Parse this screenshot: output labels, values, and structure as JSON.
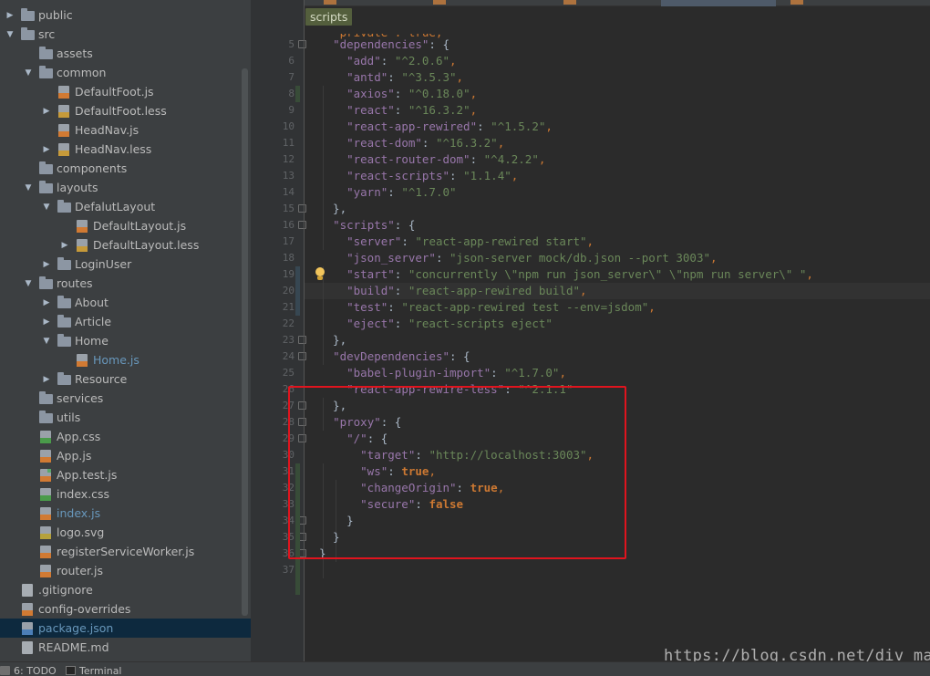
{
  "tree": [
    {
      "label": "public",
      "kind": "folder",
      "depth": 0,
      "arrow": "collapsed"
    },
    {
      "label": "src",
      "kind": "folder",
      "depth": 0,
      "arrow": "expanded"
    },
    {
      "label": "assets",
      "kind": "folder",
      "depth": 1,
      "arrow": "none"
    },
    {
      "label": "common",
      "kind": "folder",
      "depth": 1,
      "arrow": "expanded"
    },
    {
      "label": "DefaultFoot.js",
      "kind": "js",
      "depth": 2,
      "arrow": "none"
    },
    {
      "label": "DefaultFoot.less",
      "kind": "less",
      "depth": 2,
      "arrow": "collapsed"
    },
    {
      "label": "HeadNav.js",
      "kind": "js",
      "depth": 2,
      "arrow": "none"
    },
    {
      "label": "HeadNav.less",
      "kind": "less",
      "depth": 2,
      "arrow": "collapsed"
    },
    {
      "label": "components",
      "kind": "folder",
      "depth": 1,
      "arrow": "none"
    },
    {
      "label": "layouts",
      "kind": "folder",
      "depth": 1,
      "arrow": "expanded"
    },
    {
      "label": "DefalutLayout",
      "kind": "folder",
      "depth": 2,
      "arrow": "expanded"
    },
    {
      "label": "DefaultLayout.js",
      "kind": "js",
      "depth": 3,
      "arrow": "none"
    },
    {
      "label": "DefaultLayout.less",
      "kind": "less",
      "depth": 3,
      "arrow": "collapsed"
    },
    {
      "label": "LoginUser",
      "kind": "folder",
      "depth": 2,
      "arrow": "collapsed"
    },
    {
      "label": "routes",
      "kind": "folder",
      "depth": 1,
      "arrow": "expanded"
    },
    {
      "label": "About",
      "kind": "folder",
      "depth": 2,
      "arrow": "collapsed"
    },
    {
      "label": "Article",
      "kind": "folder",
      "depth": 2,
      "arrow": "collapsed"
    },
    {
      "label": "Home",
      "kind": "folder",
      "depth": 2,
      "arrow": "expanded"
    },
    {
      "label": "Home.js",
      "kind": "js",
      "depth": 3,
      "arrow": "none",
      "modified": true
    },
    {
      "label": "Resource",
      "kind": "folder",
      "depth": 2,
      "arrow": "collapsed"
    },
    {
      "label": "services",
      "kind": "folder",
      "depth": 1,
      "arrow": "none"
    },
    {
      "label": "utils",
      "kind": "folder",
      "depth": 1,
      "arrow": "none"
    },
    {
      "label": "App.css",
      "kind": "css",
      "depth": 1,
      "arrow": "none"
    },
    {
      "label": "App.js",
      "kind": "js",
      "depth": 1,
      "arrow": "none"
    },
    {
      "label": "App.test.js",
      "kind": "test",
      "depth": 1,
      "arrow": "none"
    },
    {
      "label": "index.css",
      "kind": "css",
      "depth": 1,
      "arrow": "none"
    },
    {
      "label": "index.js",
      "kind": "js",
      "depth": 1,
      "arrow": "none",
      "modified": true
    },
    {
      "label": "logo.svg",
      "kind": "svg",
      "depth": 1,
      "arrow": "none"
    },
    {
      "label": "registerServiceWorker.js",
      "kind": "js",
      "depth": 1,
      "arrow": "none"
    },
    {
      "label": "router.js",
      "kind": "js",
      "depth": 1,
      "arrow": "none"
    },
    {
      "label": ".gitignore",
      "kind": "plain",
      "depth": 0,
      "arrow": "none"
    },
    {
      "label": "config-overrides",
      "kind": "js",
      "depth": 0,
      "arrow": "none"
    },
    {
      "label": "package.json",
      "kind": "json",
      "depth": 0,
      "arrow": "none",
      "selected": true,
      "modified": true
    },
    {
      "label": "README.md",
      "kind": "plain",
      "depth": 0,
      "arrow": "none"
    }
  ],
  "editor": {
    "breadcrumb": "scripts",
    "partial_top_line": "  \"private\": true,",
    "lines": [
      {
        "n": "5",
        "t": [
          [
            "w",
            "  "
          ],
          [
            "k",
            "\"dependencies\""
          ],
          [
            "w",
            ": {"
          ]
        ]
      },
      {
        "n": "6",
        "t": [
          [
            "w",
            "    "
          ],
          [
            "k",
            "\"add\""
          ],
          [
            "w",
            ": "
          ],
          [
            "s",
            "\"^2.0.6\""
          ],
          [
            "p",
            ","
          ]
        ]
      },
      {
        "n": "7",
        "t": [
          [
            "w",
            "    "
          ],
          [
            "k",
            "\"antd\""
          ],
          [
            "w",
            ": "
          ],
          [
            "s",
            "\"^3.5.3\""
          ],
          [
            "p",
            ","
          ]
        ]
      },
      {
        "n": "8",
        "t": [
          [
            "w",
            "    "
          ],
          [
            "k",
            "\"axios\""
          ],
          [
            "w",
            ": "
          ],
          [
            "s",
            "\"^0.18.0\""
          ],
          [
            "p",
            ","
          ]
        ]
      },
      {
        "n": "9",
        "t": [
          [
            "w",
            "    "
          ],
          [
            "k",
            "\"react\""
          ],
          [
            "w",
            ": "
          ],
          [
            "s",
            "\"^16.3.2\""
          ],
          [
            "p",
            ","
          ]
        ]
      },
      {
        "n": "10",
        "t": [
          [
            "w",
            "    "
          ],
          [
            "k",
            "\"react-app-rewired\""
          ],
          [
            "w",
            ": "
          ],
          [
            "s",
            "\"^1.5.2\""
          ],
          [
            "p",
            ","
          ]
        ]
      },
      {
        "n": "11",
        "t": [
          [
            "w",
            "    "
          ],
          [
            "k",
            "\"react-dom\""
          ],
          [
            "w",
            ": "
          ],
          [
            "s",
            "\"^16.3.2\""
          ],
          [
            "p",
            ","
          ]
        ]
      },
      {
        "n": "12",
        "t": [
          [
            "w",
            "    "
          ],
          [
            "k",
            "\"react-router-dom\""
          ],
          [
            "w",
            ": "
          ],
          [
            "s",
            "\"^4.2.2\""
          ],
          [
            "p",
            ","
          ]
        ]
      },
      {
        "n": "13",
        "t": [
          [
            "w",
            "    "
          ],
          [
            "k",
            "\"react-scripts\""
          ],
          [
            "w",
            ": "
          ],
          [
            "s",
            "\"1.1.4\""
          ],
          [
            "p",
            ","
          ]
        ]
      },
      {
        "n": "14",
        "t": [
          [
            "w",
            "    "
          ],
          [
            "k",
            "\"yarn\""
          ],
          [
            "w",
            ": "
          ],
          [
            "s",
            "\"^1.7.0\""
          ]
        ]
      },
      {
        "n": "15",
        "t": [
          [
            "w",
            "  },"
          ]
        ]
      },
      {
        "n": "16",
        "t": [
          [
            "w",
            "  "
          ],
          [
            "k",
            "\"scripts\""
          ],
          [
            "w",
            ": {"
          ]
        ]
      },
      {
        "n": "17",
        "t": [
          [
            "w",
            "    "
          ],
          [
            "k",
            "\"server\""
          ],
          [
            "w",
            ": "
          ],
          [
            "s",
            "\"react-app-rewired start\""
          ],
          [
            "p",
            ","
          ]
        ]
      },
      {
        "n": "18",
        "t": [
          [
            "w",
            "    "
          ],
          [
            "k",
            "\"json_server\""
          ],
          [
            "w",
            ": "
          ],
          [
            "s",
            "\"json-server mock/db.json --port 3003\""
          ],
          [
            "p",
            ","
          ]
        ]
      },
      {
        "n": "19",
        "t": [
          [
            "w",
            "    "
          ],
          [
            "k",
            "\"start\""
          ],
          [
            "w",
            ": "
          ],
          [
            "s",
            "\"concurrently \\\"npm run json_server\\\" \\\"npm run server\\\" \""
          ],
          [
            "p",
            ","
          ]
        ]
      },
      {
        "n": "20",
        "t": [
          [
            "w",
            "    "
          ],
          [
            "k",
            "\"build\""
          ],
          [
            "w",
            ": "
          ],
          [
            "s",
            "\"react-app-rewired build\""
          ],
          [
            "p",
            ","
          ]
        ]
      },
      {
        "n": "21",
        "t": [
          [
            "w",
            "    "
          ],
          [
            "k",
            "\"test\""
          ],
          [
            "w",
            ": "
          ],
          [
            "s",
            "\"react-app-rewired test --env=jsdom\""
          ],
          [
            "p",
            ","
          ]
        ]
      },
      {
        "n": "22",
        "t": [
          [
            "w",
            "    "
          ],
          [
            "k",
            "\"eject\""
          ],
          [
            "w",
            ": "
          ],
          [
            "s",
            "\"react-scripts eject\""
          ]
        ]
      },
      {
        "n": "23",
        "t": [
          [
            "w",
            "  },"
          ]
        ]
      },
      {
        "n": "24",
        "t": [
          [
            "w",
            "  "
          ],
          [
            "k",
            "\"devDependencies\""
          ],
          [
            "w",
            ": {"
          ]
        ]
      },
      {
        "n": "25",
        "t": [
          [
            "w",
            "    "
          ],
          [
            "k",
            "\"babel-plugin-import\""
          ],
          [
            "w",
            ": "
          ],
          [
            "s",
            "\"^1.7.0\""
          ],
          [
            "p",
            ","
          ]
        ]
      },
      {
        "n": "26",
        "t": [
          [
            "w",
            "    "
          ],
          [
            "k",
            "\"react-app-rewire-less\""
          ],
          [
            "w",
            ": "
          ],
          [
            "s",
            "\"^2.1.1\""
          ]
        ]
      },
      {
        "n": "27",
        "t": [
          [
            "w",
            "  },"
          ]
        ]
      },
      {
        "n": "28",
        "t": [
          [
            "w",
            "  "
          ],
          [
            "k",
            "\"proxy\""
          ],
          [
            "w",
            ": {"
          ]
        ]
      },
      {
        "n": "29",
        "t": [
          [
            "w",
            "    "
          ],
          [
            "k",
            "\"/\""
          ],
          [
            "w",
            ": {"
          ]
        ]
      },
      {
        "n": "30",
        "t": [
          [
            "w",
            "      "
          ],
          [
            "k",
            "\"target\""
          ],
          [
            "w",
            ": "
          ],
          [
            "s",
            "\"http://localhost:3003\""
          ],
          [
            "p",
            ","
          ]
        ]
      },
      {
        "n": "31",
        "t": [
          [
            "w",
            "      "
          ],
          [
            "k",
            "\"ws\""
          ],
          [
            "w",
            ": "
          ],
          [
            "b",
            "true"
          ],
          [
            "p",
            ","
          ]
        ]
      },
      {
        "n": "32",
        "t": [
          [
            "w",
            "      "
          ],
          [
            "k",
            "\"changeOrigin\""
          ],
          [
            "w",
            ": "
          ],
          [
            "b",
            "true"
          ],
          [
            "p",
            ","
          ]
        ]
      },
      {
        "n": "33",
        "t": [
          [
            "w",
            "      "
          ],
          [
            "k",
            "\"secure\""
          ],
          [
            "w",
            ": "
          ],
          [
            "b",
            "false"
          ]
        ]
      },
      {
        "n": "34",
        "t": [
          [
            "w",
            "    }"
          ]
        ]
      },
      {
        "n": "35",
        "t": [
          [
            "w",
            "  }"
          ]
        ]
      },
      {
        "n": "36",
        "t": [
          [
            "w",
            "}"
          ]
        ]
      },
      {
        "n": "37",
        "t": []
      }
    ],
    "watermark": "https://blog.csdn.net/div_ma"
  },
  "statusbar": {
    "todo": "6: TODO",
    "terminal": "Terminal"
  }
}
